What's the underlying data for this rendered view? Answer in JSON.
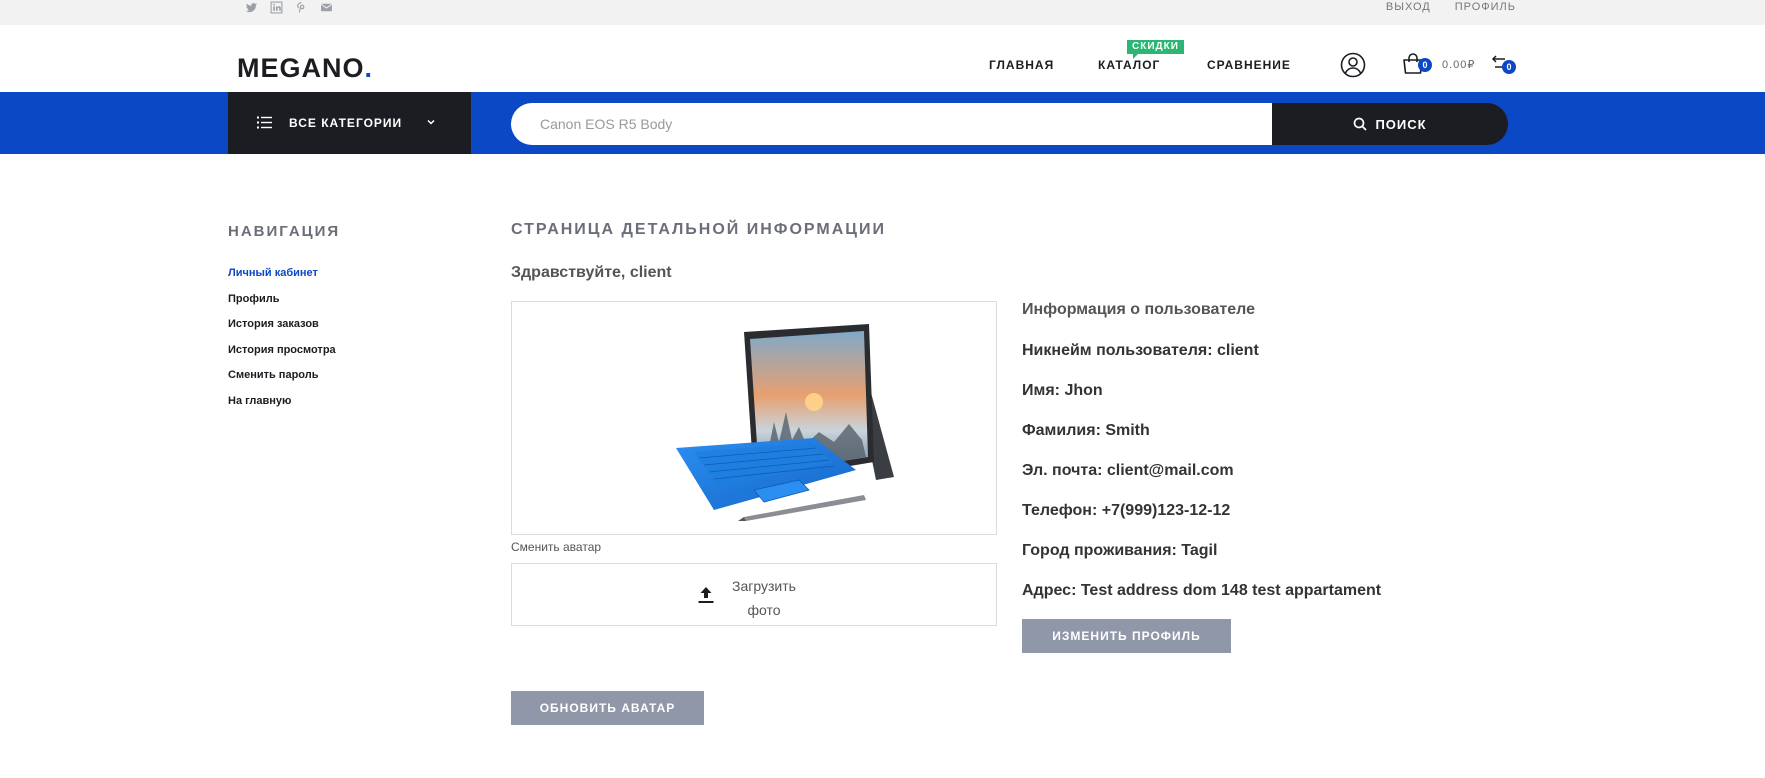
{
  "topbar": {
    "social_icons": [
      "twitter-icon",
      "linkedin-icon",
      "pinterest-icon",
      "mail-icon"
    ],
    "links": [
      "ВЫХОД",
      "ПРОФИЛЬ"
    ]
  },
  "header": {
    "logo": "MEGANO.",
    "nav": [
      "ГЛАВНАЯ",
      "КАТАЛОГ",
      "СРАВНЕНИЕ"
    ],
    "catalog_badge": "СКИДКИ",
    "cart_count": "0",
    "cart_total": "0.00₽",
    "compare_count": "0"
  },
  "searchbar": {
    "categories_label": "ВСЕ КАТЕГОРИИ",
    "placeholder": "Canon EOS R5 Body",
    "button_label": "ПОИСК"
  },
  "sidebar": {
    "title": "НАВИГАЦИЯ",
    "items": [
      "Личный кабинет",
      "Профиль",
      "История заказов",
      "История просмотра",
      "Сменить пароль",
      "На главную"
    ],
    "active_index": 0
  },
  "main": {
    "title": "СТРАНИЦА ДЕТАЛЬНОЙ ИНФОРМАЦИИ",
    "greeting": "Здравствуйте, client",
    "change_avatar_label": "Сменить аватар",
    "upload_label_line1": "Загрузить",
    "upload_label_line2": "фото",
    "update_avatar_button": "ОБНОВИТЬ АВАТАР",
    "info_title": "Информация о пользователе",
    "info": [
      "Никнейм пользователя: client",
      "Имя: Jhon",
      "Фамилия: Smith",
      "Эл. почта: client@mail.com",
      "Телефон: +7(999)123-12-12",
      "Город проживания: Tagil",
      "Адрес: Test address dom 148 test appartament"
    ],
    "edit_profile_button": "ИЗМЕНИТЬ ПРОФИЛЬ"
  },
  "colors": {
    "brand_blue": "#0b48c6",
    "dark": "#1c1d22",
    "badge_green": "#2bb673",
    "button_gray": "#9097a8"
  }
}
